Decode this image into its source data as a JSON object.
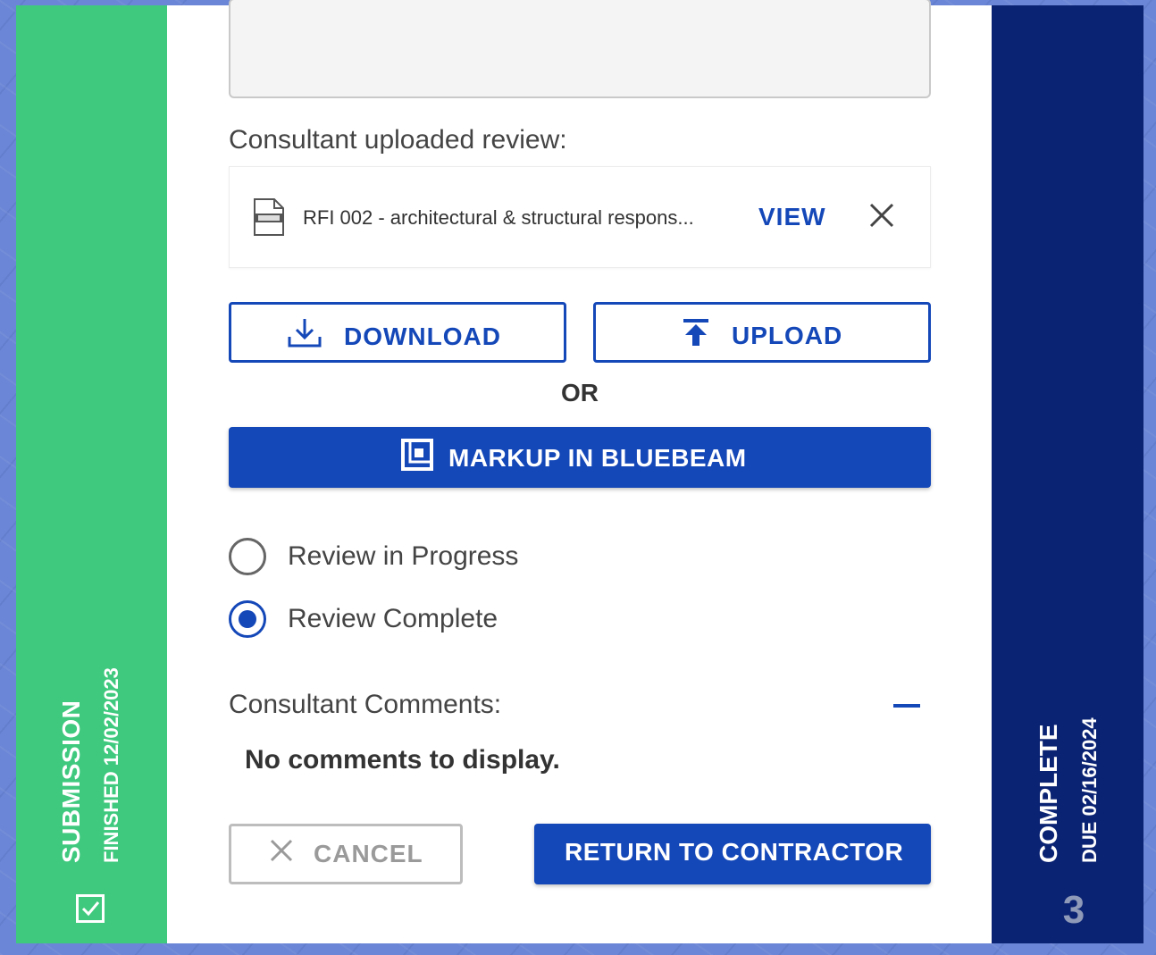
{
  "stages": {
    "left": {
      "title": "SUBMISSION",
      "subtitle": "FINISHED 12/02/2023",
      "color": "#3fc97e",
      "checked": true
    },
    "right": {
      "title": "COMPLETE",
      "subtitle": "DUE 02/16/2024",
      "number": "3",
      "color": "#0b2373"
    }
  },
  "review": {
    "uploaded_label": "Consultant uploaded review:",
    "file": {
      "icon": "pdf-file-icon",
      "name": "RFI 002 - architectural & structural respons...",
      "view_label": "VIEW"
    },
    "download_label": "DOWNLOAD",
    "upload_label": "UPLOAD",
    "or_label": "OR",
    "bluebeam_label": "MARKUP IN BLUEBEAM",
    "status_options": [
      {
        "label": "Review in Progress",
        "selected": false
      },
      {
        "label": "Review Complete",
        "selected": true
      }
    ],
    "comments_label": "Consultant Comments:",
    "no_comments": "No comments to display.",
    "cancel_label": "CANCEL",
    "return_label": "RETURN TO CONTRACTOR"
  },
  "colors": {
    "accent": "#1447b8",
    "background": "#6b86d6"
  }
}
